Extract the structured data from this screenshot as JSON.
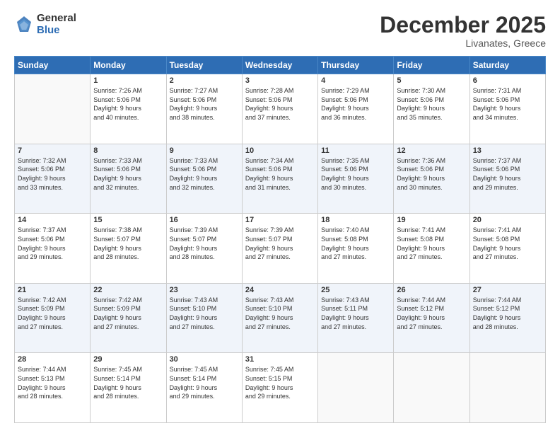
{
  "logo": {
    "general": "General",
    "blue": "Blue"
  },
  "title": "December 2025",
  "subtitle": "Livanates, Greece",
  "days_header": [
    "Sunday",
    "Monday",
    "Tuesday",
    "Wednesday",
    "Thursday",
    "Friday",
    "Saturday"
  ],
  "weeks": [
    [
      {
        "num": "",
        "info": ""
      },
      {
        "num": "1",
        "info": "Sunrise: 7:26 AM\nSunset: 5:06 PM\nDaylight: 9 hours\nand 40 minutes."
      },
      {
        "num": "2",
        "info": "Sunrise: 7:27 AM\nSunset: 5:06 PM\nDaylight: 9 hours\nand 38 minutes."
      },
      {
        "num": "3",
        "info": "Sunrise: 7:28 AM\nSunset: 5:06 PM\nDaylight: 9 hours\nand 37 minutes."
      },
      {
        "num": "4",
        "info": "Sunrise: 7:29 AM\nSunset: 5:06 PM\nDaylight: 9 hours\nand 36 minutes."
      },
      {
        "num": "5",
        "info": "Sunrise: 7:30 AM\nSunset: 5:06 PM\nDaylight: 9 hours\nand 35 minutes."
      },
      {
        "num": "6",
        "info": "Sunrise: 7:31 AM\nSunset: 5:06 PM\nDaylight: 9 hours\nand 34 minutes."
      }
    ],
    [
      {
        "num": "7",
        "info": "Sunrise: 7:32 AM\nSunset: 5:06 PM\nDaylight: 9 hours\nand 33 minutes."
      },
      {
        "num": "8",
        "info": "Sunrise: 7:33 AM\nSunset: 5:06 PM\nDaylight: 9 hours\nand 32 minutes."
      },
      {
        "num": "9",
        "info": "Sunrise: 7:33 AM\nSunset: 5:06 PM\nDaylight: 9 hours\nand 32 minutes."
      },
      {
        "num": "10",
        "info": "Sunrise: 7:34 AM\nSunset: 5:06 PM\nDaylight: 9 hours\nand 31 minutes."
      },
      {
        "num": "11",
        "info": "Sunrise: 7:35 AM\nSunset: 5:06 PM\nDaylight: 9 hours\nand 30 minutes."
      },
      {
        "num": "12",
        "info": "Sunrise: 7:36 AM\nSunset: 5:06 PM\nDaylight: 9 hours\nand 30 minutes."
      },
      {
        "num": "13",
        "info": "Sunrise: 7:37 AM\nSunset: 5:06 PM\nDaylight: 9 hours\nand 29 minutes."
      }
    ],
    [
      {
        "num": "14",
        "info": "Sunrise: 7:37 AM\nSunset: 5:06 PM\nDaylight: 9 hours\nand 29 minutes."
      },
      {
        "num": "15",
        "info": "Sunrise: 7:38 AM\nSunset: 5:07 PM\nDaylight: 9 hours\nand 28 minutes."
      },
      {
        "num": "16",
        "info": "Sunrise: 7:39 AM\nSunset: 5:07 PM\nDaylight: 9 hours\nand 28 minutes."
      },
      {
        "num": "17",
        "info": "Sunrise: 7:39 AM\nSunset: 5:07 PM\nDaylight: 9 hours\nand 27 minutes."
      },
      {
        "num": "18",
        "info": "Sunrise: 7:40 AM\nSunset: 5:08 PM\nDaylight: 9 hours\nand 27 minutes."
      },
      {
        "num": "19",
        "info": "Sunrise: 7:41 AM\nSunset: 5:08 PM\nDaylight: 9 hours\nand 27 minutes."
      },
      {
        "num": "20",
        "info": "Sunrise: 7:41 AM\nSunset: 5:08 PM\nDaylight: 9 hours\nand 27 minutes."
      }
    ],
    [
      {
        "num": "21",
        "info": "Sunrise: 7:42 AM\nSunset: 5:09 PM\nDaylight: 9 hours\nand 27 minutes."
      },
      {
        "num": "22",
        "info": "Sunrise: 7:42 AM\nSunset: 5:09 PM\nDaylight: 9 hours\nand 27 minutes."
      },
      {
        "num": "23",
        "info": "Sunrise: 7:43 AM\nSunset: 5:10 PM\nDaylight: 9 hours\nand 27 minutes."
      },
      {
        "num": "24",
        "info": "Sunrise: 7:43 AM\nSunset: 5:10 PM\nDaylight: 9 hours\nand 27 minutes."
      },
      {
        "num": "25",
        "info": "Sunrise: 7:43 AM\nSunset: 5:11 PM\nDaylight: 9 hours\nand 27 minutes."
      },
      {
        "num": "26",
        "info": "Sunrise: 7:44 AM\nSunset: 5:12 PM\nDaylight: 9 hours\nand 27 minutes."
      },
      {
        "num": "27",
        "info": "Sunrise: 7:44 AM\nSunset: 5:12 PM\nDaylight: 9 hours\nand 28 minutes."
      }
    ],
    [
      {
        "num": "28",
        "info": "Sunrise: 7:44 AM\nSunset: 5:13 PM\nDaylight: 9 hours\nand 28 minutes."
      },
      {
        "num": "29",
        "info": "Sunrise: 7:45 AM\nSunset: 5:14 PM\nDaylight: 9 hours\nand 28 minutes."
      },
      {
        "num": "30",
        "info": "Sunrise: 7:45 AM\nSunset: 5:14 PM\nDaylight: 9 hours\nand 29 minutes."
      },
      {
        "num": "31",
        "info": "Sunrise: 7:45 AM\nSunset: 5:15 PM\nDaylight: 9 hours\nand 29 minutes."
      },
      {
        "num": "",
        "info": ""
      },
      {
        "num": "",
        "info": ""
      },
      {
        "num": "",
        "info": ""
      }
    ]
  ]
}
